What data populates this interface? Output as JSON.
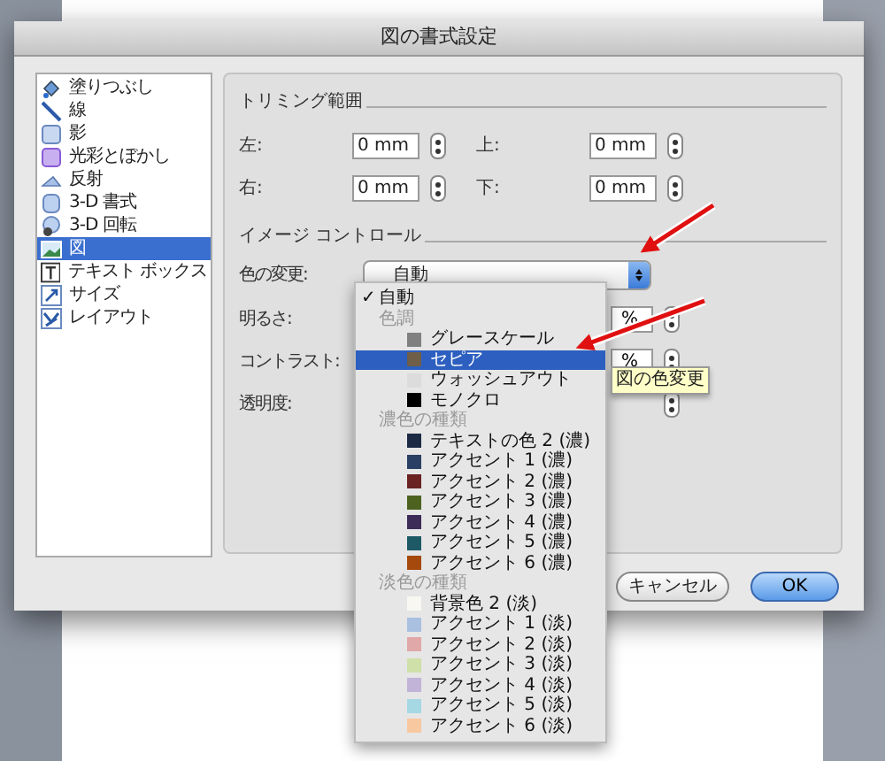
{
  "window": {
    "title": "図の書式設定"
  },
  "sidebar": {
    "items": [
      {
        "label": "塗りつぶし",
        "kind": "fill",
        "selected": false
      },
      {
        "label": "線",
        "kind": "line",
        "selected": false
      },
      {
        "label": "影",
        "kind": "shadow",
        "selected": false
      },
      {
        "label": "光彩とぼかし",
        "kind": "glow",
        "selected": false
      },
      {
        "label": "反射",
        "kind": "reflection",
        "selected": false
      },
      {
        "label": "3-D 書式",
        "kind": "format3d",
        "selected": false
      },
      {
        "label": "3-D 回転",
        "kind": "rotate3d",
        "selected": false
      },
      {
        "label": "図",
        "kind": "picture",
        "selected": true
      },
      {
        "label": "テキスト ボックス",
        "kind": "textbox",
        "selected": false
      },
      {
        "label": "サイズ",
        "kind": "size",
        "selected": false
      },
      {
        "label": "レイアウト",
        "kind": "layout",
        "selected": false
      }
    ]
  },
  "crop": {
    "title": "トリミング範囲",
    "fields": [
      {
        "label": "左:",
        "value": "0 mm"
      },
      {
        "label": "上:",
        "value": "0 mm"
      },
      {
        "label": "右:",
        "value": "0 mm"
      },
      {
        "label": "下:",
        "value": "0 mm"
      }
    ]
  },
  "image_control": {
    "title": "イメージ コントロール",
    "recolor": {
      "label": "色の変更:",
      "value": "自動"
    },
    "brightness": {
      "label": "明るさ:",
      "value": "%"
    },
    "contrast": {
      "label": "コントラスト:",
      "value": "%"
    },
    "transparency": {
      "label": "透明度:"
    }
  },
  "menu": {
    "items": [
      {
        "kind": "check",
        "mark": "✓",
        "label": "自動",
        "checked": true,
        "selected": false
      },
      {
        "kind": "header",
        "label": "色調"
      },
      {
        "kind": "swatch",
        "label": "グレースケール",
        "color": "#808080",
        "selected": false
      },
      {
        "kind": "swatch",
        "label": "セピア",
        "color": "#6f5e48",
        "selected": true
      },
      {
        "kind": "swatch",
        "label": "ウォッシュアウト",
        "color": "#dcdcdc",
        "selected": false
      },
      {
        "kind": "swatch",
        "label": "モノクロ",
        "color": "#000000",
        "selected": false
      },
      {
        "kind": "header",
        "label": "濃色の種類"
      },
      {
        "kind": "swatch",
        "label": "テキストの色 2 (濃)",
        "color": "#1c2a44",
        "selected": false
      },
      {
        "kind": "swatch",
        "label": "アクセント 1 (濃)",
        "color": "#2a4064",
        "selected": false
      },
      {
        "kind": "swatch",
        "label": "アクセント 2 (濃)",
        "color": "#6a2222",
        "selected": false
      },
      {
        "kind": "swatch",
        "label": "アクセント 3 (濃)",
        "color": "#4e6220",
        "selected": false
      },
      {
        "kind": "swatch",
        "label": "アクセント 4 (濃)",
        "color": "#3d2c58",
        "selected": false
      },
      {
        "kind": "swatch",
        "label": "アクセント 5 (濃)",
        "color": "#1e5a66",
        "selected": false
      },
      {
        "kind": "swatch",
        "label": "アクセント 6 (濃)",
        "color": "#a5490c",
        "selected": false
      },
      {
        "kind": "header",
        "label": "淡色の種類"
      },
      {
        "kind": "swatch",
        "label": "背景色 2 (淡)",
        "color": "#f8f7f2",
        "selected": false
      },
      {
        "kind": "swatch",
        "label": "アクセント 1 (淡)",
        "color": "#a9c0e0",
        "selected": false
      },
      {
        "kind": "swatch",
        "label": "アクセント 2 (淡)",
        "color": "#e0a8a8",
        "selected": false
      },
      {
        "kind": "swatch",
        "label": "アクセント 3 (淡)",
        "color": "#cfe0a8",
        "selected": false
      },
      {
        "kind": "swatch",
        "label": "アクセント 4 (淡)",
        "color": "#c2b4d8",
        "selected": false
      },
      {
        "kind": "swatch",
        "label": "アクセント 5 (淡)",
        "color": "#a6d8e4",
        "selected": false
      },
      {
        "kind": "swatch",
        "label": "アクセント 6 (淡)",
        "color": "#f8c8a0",
        "selected": false
      }
    ]
  },
  "tooltip": {
    "text": "図の色変更"
  },
  "buttons": [
    {
      "label": "キャンセル",
      "kind": "cancel"
    },
    {
      "label": "OK",
      "kind": "default"
    }
  ]
}
